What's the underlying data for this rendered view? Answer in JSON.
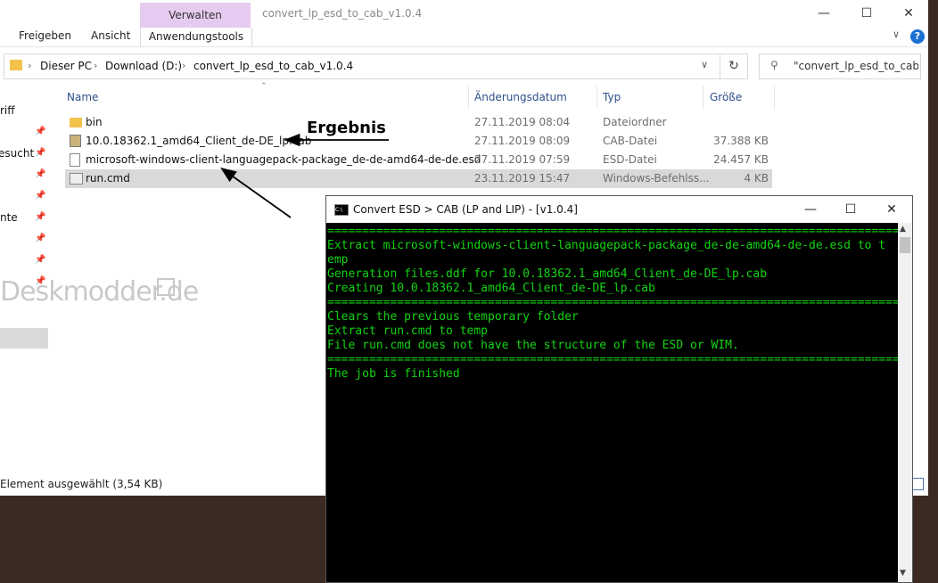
{
  "explorer": {
    "title": "convert_lp_esd_to_cab_v1.0.4",
    "ribbon": {
      "context_group": "Verwalten",
      "tabs": [
        "Freigeben",
        "Ansicht",
        "Anwendungstools"
      ]
    },
    "address": {
      "crumbs": [
        "Dieser PC",
        "Download (D:)",
        "convert_lp_esd_to_cab_v1.0.4"
      ]
    },
    "search_text": "\"convert_lp_esd_to_cab...",
    "nav_items": [
      "riff",
      "esucht",
      "nte"
    ],
    "watermark": "Deskmodder.de",
    "columns": [
      "Name",
      "Änderungsdatum",
      "Typ",
      "Größe"
    ],
    "files": [
      {
        "name": "bin",
        "date": "27.11.2019 08:04",
        "type": "Dateiordner",
        "size": "",
        "icon": "folder-icon"
      },
      {
        "name": "10.0.18362.1_amd64_Client_de-DE_lp.cab",
        "date": "27.11.2019 08:09",
        "type": "CAB-Datei",
        "size": "37.388 KB",
        "icon": "cab-file-icon"
      },
      {
        "name": "microsoft-windows-client-languagepack-package_de-de-amd64-de-de.esd",
        "date": "27.11.2019 07:59",
        "type": "ESD-Datei",
        "size": "24.457 KB",
        "icon": "file-icon"
      },
      {
        "name": "run.cmd",
        "date": "23.11.2019 15:47",
        "type": "Windows-Befehlss...",
        "size": "4 KB",
        "icon": "cmd-file-icon"
      }
    ],
    "annotation": "Ergebnis",
    "status": "Element ausgewählt (3,54 KB)"
  },
  "console": {
    "title": "Convert ESD > CAB (LP and LIP) - [v1.0.4]",
    "lines": [
      "=======================================================================================",
      "Extract microsoft-windows-client-languagepack-package_de-de-amd64-de-de.esd to t",
      "emp",
      "Generation files.ddf for 10.0.18362.1_amd64_Client_de-DE_lp.cab",
      "Creating 10.0.18362.1_amd64_Client_de-DE_lp.cab",
      "=======================================================================================",
      "Clears the previous temporary folder",
      "Extract run.cmd to temp",
      "File run.cmd does not have the structure of the ESD or WIM.",
      "=======================================================================================",
      "The job is finished"
    ]
  }
}
